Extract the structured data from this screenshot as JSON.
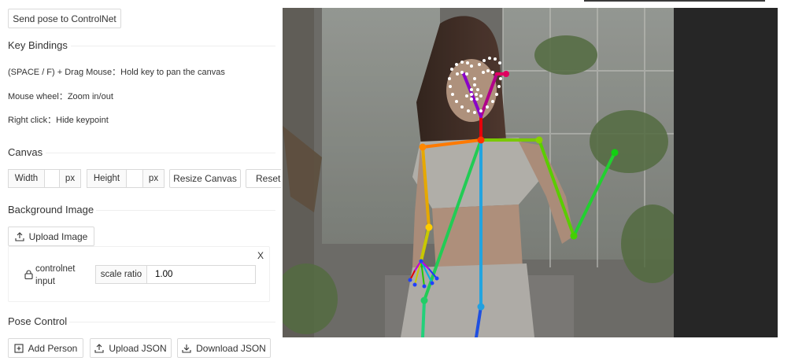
{
  "buttons": {
    "send_pose": "Send pose to ControlNet",
    "resize_canvas": "Resize Canvas",
    "reset": "Reset",
    "upload_image": "Upload Image",
    "add_person": "Add Person",
    "upload_json": "Upload JSON",
    "download_json": "Download JSON"
  },
  "key_bindings": {
    "title": "Key Bindings",
    "items": [
      "(SPACE / F) + Drag Mouse：Hold key to pan the canvas",
      "Mouse wheel：Zoom in/out",
      "Right click：Hide keypoint"
    ]
  },
  "canvas": {
    "title": "Canvas",
    "width_label": "Width",
    "height_label": "Height",
    "unit": "px",
    "width_value": "",
    "height_value": ""
  },
  "background": {
    "title": "Background Image",
    "layer_name": "controlnet input",
    "layer_name_line1": "controlnet",
    "layer_name_line2": "input",
    "scale_label": "scale ratio",
    "scale_value": "1.00",
    "close_label": "X"
  },
  "pose_control": {
    "title": "Pose Control"
  },
  "icons": {
    "lock": "lock-icon",
    "upload": "upload-icon",
    "download": "download-icon",
    "add": "plus-square-icon"
  },
  "colors": {
    "dark_panel": "#262626",
    "image_overlay": "#7a7a7a"
  }
}
